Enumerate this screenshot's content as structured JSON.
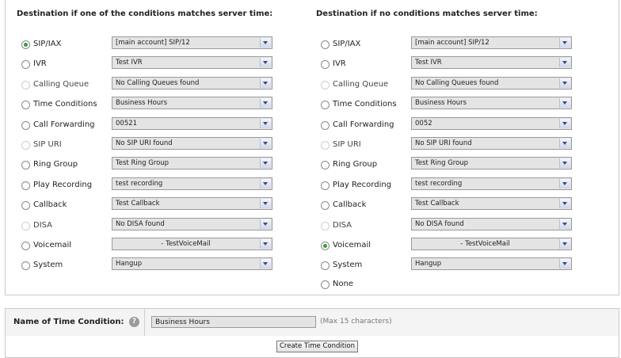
{
  "left": {
    "title": "Destination if one of the conditions matches server time:",
    "rows": [
      {
        "label": "SIP/IAX",
        "value": "[main account] SIP/12",
        "checked": true,
        "disabled": false
      },
      {
        "label": "IVR",
        "value": "Test IVR",
        "checked": false,
        "disabled": false
      },
      {
        "label": "Calling Queue",
        "value": "No Calling Queues found",
        "checked": false,
        "disabled": true
      },
      {
        "label": "Time Conditions",
        "value": "Business Hours",
        "checked": false,
        "disabled": false
      },
      {
        "label": "Call Forwarding",
        "value": "00521",
        "checked": false,
        "disabled": false
      },
      {
        "label": "SIP URI",
        "value": "No SIP URI found",
        "checked": false,
        "disabled": true
      },
      {
        "label": "Ring Group",
        "value": "Test Ring Group",
        "checked": false,
        "disabled": false
      },
      {
        "label": "Play Recording",
        "value": "test recording",
        "checked": false,
        "disabled": false
      },
      {
        "label": "Callback",
        "value": "Test Callback",
        "checked": false,
        "disabled": false
      },
      {
        "label": "DISA",
        "value": "No DISA found",
        "checked": false,
        "disabled": true
      },
      {
        "label": "Voicemail",
        "value": "- TestVoiceMail",
        "checked": false,
        "disabled": false
      },
      {
        "label": "System",
        "value": "Hangup",
        "checked": false,
        "disabled": false
      }
    ]
  },
  "right": {
    "title": "Destination if no conditions matches server time:",
    "rows": [
      {
        "label": "SIP/IAX",
        "value": "[main account] SIP/12",
        "checked": false,
        "disabled": false
      },
      {
        "label": "IVR",
        "value": "Test IVR",
        "checked": false,
        "disabled": false
      },
      {
        "label": "Calling Queue",
        "value": "No Calling Queues found",
        "checked": false,
        "disabled": true
      },
      {
        "label": "Time Conditions",
        "value": "Business Hours",
        "checked": false,
        "disabled": false
      },
      {
        "label": "Call Forwarding",
        "value": "0052",
        "checked": false,
        "disabled": false
      },
      {
        "label": "SIP URI",
        "value": "No SIP URI found",
        "checked": false,
        "disabled": true
      },
      {
        "label": "Ring Group",
        "value": "Test Ring Group",
        "checked": false,
        "disabled": false
      },
      {
        "label": "Play Recording",
        "value": "test recording",
        "checked": false,
        "disabled": false
      },
      {
        "label": "Callback",
        "value": "Test Callback",
        "checked": false,
        "disabled": false
      },
      {
        "label": "DISA",
        "value": "No DISA found",
        "checked": false,
        "disabled": true
      },
      {
        "label": "Voicemail",
        "value": "- TestVoiceMail",
        "checked": true,
        "disabled": false
      },
      {
        "label": "System",
        "value": "Hangup",
        "checked": false,
        "disabled": false
      }
    ],
    "none_label": "None"
  },
  "name_field": {
    "label": "Name of Time Condition:",
    "help": "?",
    "value": "Business Hours",
    "hint": "(Max 15 characters)"
  },
  "create_button": "Create Time Condition"
}
